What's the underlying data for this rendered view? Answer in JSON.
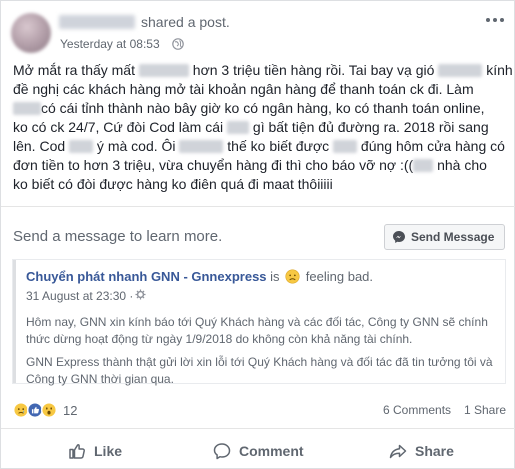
{
  "post": {
    "header": {
      "action_text": "shared a post.",
      "timestamp": "Yesterday at 08:53"
    },
    "lines": [
      [
        "Mở mắt ra thấy mất ",
        " hơn 3 triệu tiền hàng rồi. Tai bay vạ gió ",
        " kính"
      ],
      [
        "đề nghị các khách hàng mở tài khoản ngân hàng để thanh toán ck đi. Làm"
      ],
      [
        "",
        "có cái tỉnh thành nào bây giờ ko có ngân hàng, ko có thanh toán online,"
      ],
      [
        "ko có ck 24/7, Cứ đòi Cod làm cái ",
        " gì bất tiện đủ đường ra. 2018 rồi sang"
      ],
      [
        "lên. Cod ",
        " ý mà cod. Ôi ",
        " thế ko biết được ",
        " đúng hôm cửa hàng có"
      ],
      [
        "đơn tiền to hơn 3 triệu, vừa chuyển hàng đi thì cho báo vỡ nợ :((",
        " nhà cho"
      ],
      [
        "ko biết có đòi được hàng ko điên quá đi maat thôiiiii"
      ]
    ]
  },
  "message_bar": {
    "prompt": "Send a message to learn more.",
    "button_label": "Send Message"
  },
  "shared_post": {
    "page_name": "Chuyển phát nhanh GNN - Gnnexpress",
    "is_text": "is",
    "feeling": "feeling bad.",
    "timestamp": "31 August at 23:30 ·",
    "paragraph1": [
      "Hôm nay, GNN xin kính báo tới Quý Khách hàng và các đối tác, Công ty GNN sẽ chính",
      "thức dừng hoạt động từ ngày 1/9/2018 do không còn khả năng tài chính."
    ],
    "paragraph2": [
      "GNN Express thành thật gửi lời xin lỗi tới Quý Khách hàng và đối tác đã tin tưởng tôi và",
      "Công ty GNN thời gian qua."
    ]
  },
  "engagement": {
    "reactions_count": "12",
    "comments": "6 Comments",
    "shares": "1 Share",
    "reaction_icons": [
      "sad",
      "like",
      "wow"
    ]
  },
  "actions": {
    "like": "Like",
    "comment": "Comment",
    "share": "Share"
  },
  "colors": {
    "link": "#385898",
    "secondary_text": "#606770",
    "like_blue": "#4267b2",
    "reaction_yellow": "#f7c843"
  }
}
